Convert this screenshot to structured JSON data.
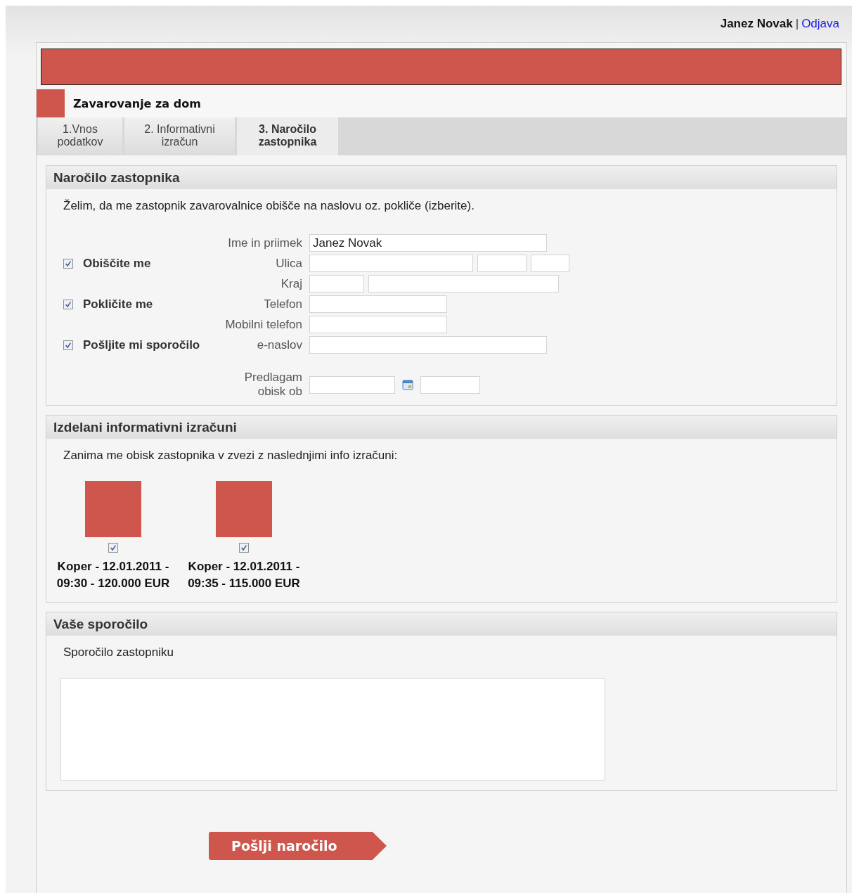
{
  "header": {
    "user": "Janez Novak",
    "separator": "|",
    "logout": "Odjava"
  },
  "product": {
    "title": "Zavarovanje za dom"
  },
  "tabs": [
    {
      "label": "1.Vnos podatkov",
      "selected": false
    },
    {
      "label": "2. Informativni izračun",
      "selected": false
    },
    {
      "label": "3. Naročilo zastopnika",
      "selected": true
    }
  ],
  "order_section": {
    "title": "Naročilo zastopnika",
    "intro": "Želim, da me zastopnik zavarovalnice obišče na naslovu oz. pokliče (izberite).",
    "rows": [
      {
        "label": "Ime in priimek",
        "fields": [
          {
            "kind": "wide",
            "value": "Janez Novak"
          }
        ]
      },
      {
        "option": {
          "label": "Obiščite me",
          "checked": true
        },
        "label": "Ulica",
        "fields": [
          {
            "kind": "street"
          },
          {
            "kind": "number"
          },
          {
            "kind": "small"
          }
        ]
      },
      {
        "label": "Kraj",
        "fields": [
          {
            "kind": "zip"
          },
          {
            "kind": "city"
          }
        ]
      },
      {
        "option": {
          "label": "Pokličite me",
          "checked": true
        },
        "label": "Telefon",
        "fields": [
          {
            "kind": "medium"
          }
        ]
      },
      {
        "label": "Mobilni telefon",
        "fields": [
          {
            "kind": "medium"
          }
        ]
      },
      {
        "option": {
          "label": "Pošljite mi sporočilo",
          "checked": true
        },
        "label": "e-naslov",
        "fields": [
          {
            "kind": "wide"
          }
        ]
      },
      {
        "label": "Predlagam obisk ob",
        "fields": [
          {
            "kind": "date"
          },
          {
            "kind": "time"
          }
        ]
      }
    ]
  },
  "calculations_section": {
    "title": "Izdelani informativni izračuni",
    "intro": "Zanima me obisk zastopnika v zvezi z naslednjimi info izračuni:",
    "items": [
      {
        "label": "Koper - 12.01.2011 - 09:30 - 120.000 EUR",
        "checked": true
      },
      {
        "label": "Koper - 12.01.2011 - 09:35 - 115.000 EUR",
        "checked": true
      }
    ]
  },
  "message_section": {
    "title": "Vaše sporočilo",
    "label": "Sporočilo zastopniku"
  },
  "submit_button": {
    "label": "Pošlji naročilo"
  }
}
